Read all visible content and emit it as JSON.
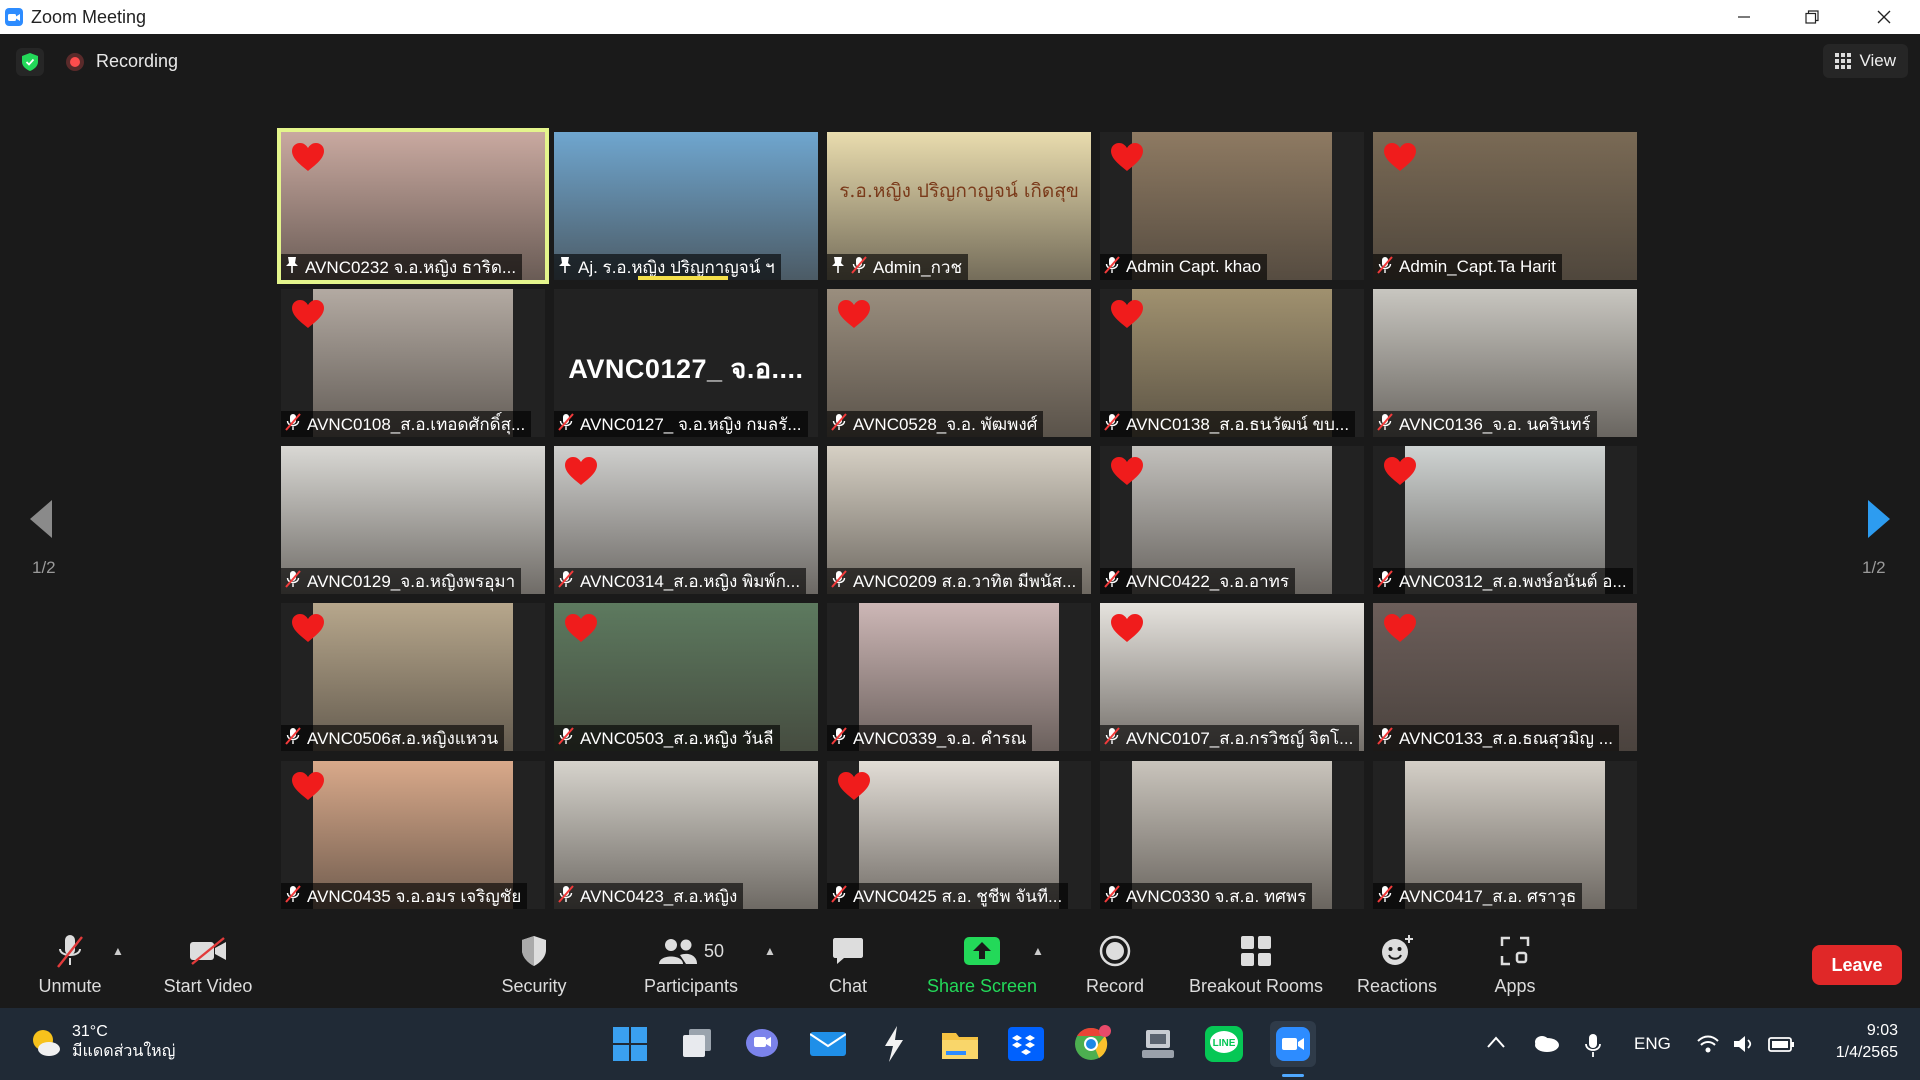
{
  "window": {
    "title": "Zoom Meeting"
  },
  "topbar": {
    "recording_label": "Recording",
    "view_label": "View"
  },
  "participants": [
    {
      "name": "AVNC0232 จ.อ.หญิง ธาริด...",
      "heart": true,
      "pinned": true,
      "active": true,
      "video_color": "#c9a9a0"
    },
    {
      "name": "Aj. ร.อ.หญิง ปริญกาญจน์ ฯ",
      "heart": false,
      "pinned": true,
      "video_color": "#6fa6cf",
      "speaking": true
    },
    {
      "name": "Admin_กวช",
      "heart": false,
      "pinned": true,
      "muted": true,
      "video_color": "#e9dcae",
      "overlay": "ร.อ.หญิง ปริญกาญจน์  เกิดสุข"
    },
    {
      "name": "Admin Capt. khao",
      "heart": true,
      "muted": true,
      "video_color": "#8e7a62"
    },
    {
      "name": "Admin_Capt.Ta Harit",
      "heart": true,
      "muted": true,
      "video_color": "#7a6a55"
    },
    {
      "name": "AVNC0108_ส.อ.เทอดศักดิ์สุ...",
      "heart": true,
      "muted": true,
      "video_color": "#b3aaa2"
    },
    {
      "name": "AVNC0127_ จ.อ.หญิง กมลรั...",
      "heart": false,
      "muted": true,
      "video_color": "",
      "display_text": "AVNC0127_ จ.อ...."
    },
    {
      "name": "AVNC0528_จ.อ. พัฒพงศ์",
      "heart": true,
      "muted": true,
      "video_color": "#9a8e7e"
    },
    {
      "name": "AVNC0138_ส.อ.ธนวัฒน์ ขบ...",
      "heart": true,
      "muted": true,
      "video_color": "#a0916f"
    },
    {
      "name": "AVNC0136_จ.อ. นครินทร์",
      "heart": false,
      "muted": true,
      "video_color": "#c8c6c0"
    },
    {
      "name": "AVNC0129_จ.อ.หญิงพรอุมา",
      "heart": false,
      "muted": true,
      "video_color": "#d9d8d4"
    },
    {
      "name": "AVNC0314_ส.อ.หญิง พิมพ์ก...",
      "heart": true,
      "muted": true,
      "video_color": "#cfcfcd"
    },
    {
      "name": "AVNC0209 ส.อ.วาทิต มีพนัส...",
      "heart": false,
      "muted": true,
      "video_color": "#d6d0c4"
    },
    {
      "name": "AVNC0422_จ.อ.อาทร",
      "heart": true,
      "muted": true,
      "video_color": "#c2c0bc"
    },
    {
      "name": "AVNC0312_ส.อ.พงษ์อนันต์ อ...",
      "heart": true,
      "muted": true,
      "video_color": "#cfd3d2"
    },
    {
      "name": "AVNC0506ส.อ.หญิงแหวน",
      "heart": true,
      "muted": true,
      "video_color": "#b7a78c"
    },
    {
      "name": "AVNC0503_ส.อ.หญิง วันลี",
      "heart": true,
      "muted": true,
      "video_color": "#5d7a5f"
    },
    {
      "name": "AVNC0339_จ.อ. คำรณ",
      "heart": false,
      "muted": true,
      "video_color": "#cdb7b6"
    },
    {
      "name": "AVNC0107_ส.อ.กรวิชญ์ จิตโ...",
      "heart": true,
      "muted": true,
      "video_color": "#e6e3de"
    },
    {
      "name": "AVNC0133_ส.อ.ธณสุวมิญ ...",
      "heart": true,
      "muted": true,
      "video_color": "#6c5e5a"
    },
    {
      "name": "AVNC0435 จ.อ.อมร  เจริญชัย",
      "heart": true,
      "muted": true,
      "video_color": "#d9a98a"
    },
    {
      "name": "AVNC0423_ส.อ.หญิง",
      "heart": false,
      "muted": true,
      "video_color": "#d6d3cc"
    },
    {
      "name": "AVNC0425 ส.อ. ชูชีพ  จันที...",
      "heart": true,
      "muted": true,
      "video_color": "#e2ddd6"
    },
    {
      "name": "AVNC0330 จ.ส.อ. ทศพร",
      "heart": false,
      "muted": true,
      "video_color": "#c9c4bc"
    },
    {
      "name": "AVNC0417_ส.อ. ศราวุธ",
      "heart": false,
      "muted": true,
      "video_color": "#d4cfc7"
    }
  ],
  "pagination": {
    "left": "1/2",
    "right": "1/2"
  },
  "toolbar": {
    "unmute": "Unmute",
    "start_video": "Start Video",
    "security": "Security",
    "participants": "Participants",
    "participants_count": "50",
    "chat": "Chat",
    "share_screen": "Share Screen",
    "record": "Record",
    "breakout_rooms": "Breakout Rooms",
    "reactions": "Reactions",
    "apps": "Apps",
    "leave": "Leave"
  },
  "taskbar": {
    "temperature": "31°C",
    "weather_desc": "มีแดดส่วนใหญ่",
    "language": "ENG",
    "time": "9:03",
    "date": "1/4/2565"
  },
  "colors": {
    "accent_green": "#23d959",
    "leave_red": "#e02828",
    "active_border": "#e4f58c",
    "heart_red": "#f01c1c"
  }
}
